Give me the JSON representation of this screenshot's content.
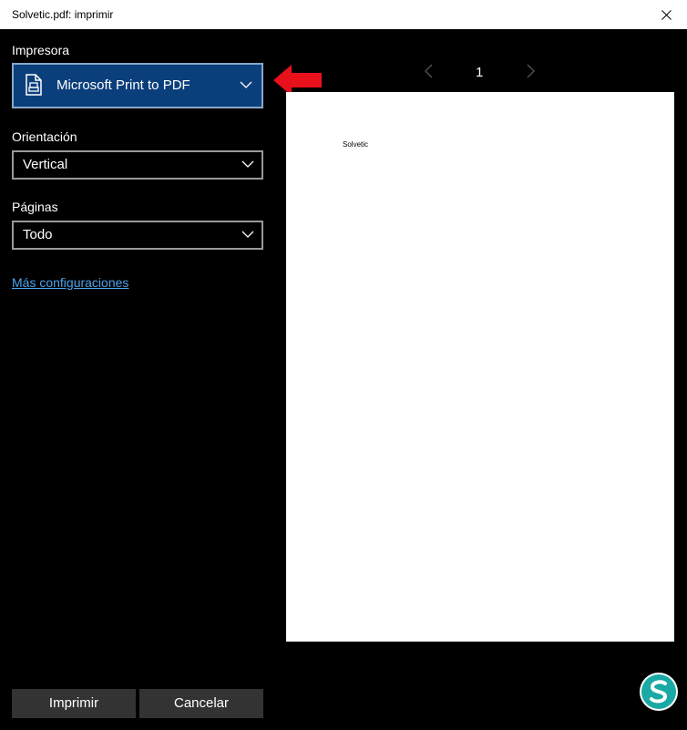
{
  "window": {
    "title": "Solvetic.pdf: imprimir",
    "close_icon": "close-icon"
  },
  "printer": {
    "label": "Impresora",
    "value": "Microsoft Print to PDF",
    "icon": "printer-document-icon"
  },
  "orientation": {
    "label": "Orientación",
    "value": "Vertical"
  },
  "pages": {
    "label": "Páginas",
    "value": "Todo"
  },
  "more_settings": "Más configuraciones",
  "pager": {
    "current_page": "1"
  },
  "preview": {
    "text": "Solvetic"
  },
  "buttons": {
    "print": "Imprimir",
    "cancel": "Cancelar"
  },
  "annotation": {
    "arrow_color": "#e8101b"
  },
  "colors": {
    "accent": "#0b3f7c",
    "link": "#4aa3f0",
    "logo": "#1aa9a4"
  }
}
